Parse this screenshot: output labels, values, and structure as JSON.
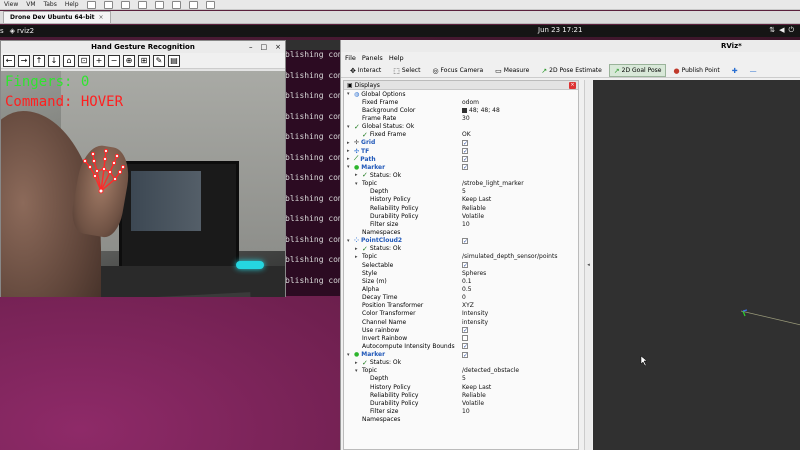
{
  "vm": {
    "menu": [
      "View",
      "VM",
      "Tabs",
      "Help"
    ],
    "tab_label": "Drone Dev Ubuntu 64-bit",
    "tab_close": "×"
  },
  "gnome": {
    "activities": "s",
    "app": "rviz2",
    "clock": "Jun 23  17:21"
  },
  "terminal": {
    "lines": [
      "blishing comma",
      "blishing comma",
      "blishing comma",
      "blishing comma",
      "blishing comma",
      "blishing comma",
      "blishing comma",
      "blishing comma",
      "blishing comma",
      "blishing comma",
      "blishing comma",
      "blishing comma"
    ]
  },
  "hand_window": {
    "title": "Hand Gesture Recognition",
    "minimize": "–",
    "maximize": "□",
    "close": "×",
    "toolbar": [
      "←",
      "→",
      "↑",
      "↓",
      "⌂",
      "⊡",
      "+",
      "−",
      "⊕",
      "⊞",
      "✎",
      "▤"
    ],
    "fingers": "Fingers: 0",
    "command": "Command: HOVER",
    "fingers_color": "#2fe52f",
    "command_color": "#ff2020"
  },
  "rviz": {
    "title": "RViz*",
    "menu": [
      "File",
      "Panels",
      "Help"
    ],
    "tools": [
      {
        "label": "Interact",
        "icon": "✥"
      },
      {
        "label": "Select",
        "icon": "⬚"
      },
      {
        "label": "Focus Camera",
        "icon": "◎"
      },
      {
        "label": "Measure",
        "icon": "▭"
      },
      {
        "label": "2D Pose Estimate",
        "icon": "↗"
      },
      {
        "label": "2D Goal Pose",
        "icon": "↗"
      },
      {
        "label": "Publish Point",
        "icon": "●"
      }
    ],
    "extra_tools": [
      "✚",
      "—"
    ],
    "displays_title": "Displays",
    "displays_close": "×",
    "splitter_arrow": "◂",
    "background_color": "#303030"
  },
  "tree": [
    {
      "indent": 0,
      "arrow": "▾",
      "icon": "globe",
      "label": "Global Options",
      "value": ""
    },
    {
      "indent": 1,
      "label": "Fixed Frame",
      "value": "odom"
    },
    {
      "indent": 1,
      "label": "Background Color",
      "value": "48; 48; 48",
      "swatch": true
    },
    {
      "indent": 1,
      "label": "Frame Rate",
      "value": "30"
    },
    {
      "indent": 0,
      "arrow": "▾",
      "check": true,
      "label": "Global Status: Ok",
      "value": ""
    },
    {
      "indent": 1,
      "check": true,
      "label": "Fixed Frame",
      "value": "OK"
    },
    {
      "indent": 0,
      "arrow": "▸",
      "icon": "grid",
      "label": "Grid",
      "value": "",
      "blue": true,
      "cbx": "✓"
    },
    {
      "indent": 0,
      "arrow": "▸",
      "icon": "tf",
      "label": "TF",
      "value": "",
      "blue": true,
      "cbx": "✓"
    },
    {
      "indent": 0,
      "arrow": "▸",
      "icon": "path",
      "label": "Path",
      "value": "",
      "blue": true,
      "cbx": "✓"
    },
    {
      "indent": 0,
      "arrow": "▾",
      "icon": "marker",
      "label": "Marker",
      "value": "",
      "blue": true,
      "cbx": "✓"
    },
    {
      "indent": 1,
      "arrow": "▸",
      "check": true,
      "label": "Status: Ok",
      "value": ""
    },
    {
      "indent": 1,
      "arrow": "▾",
      "label": "Topic",
      "value": "/strobe_light_marker"
    },
    {
      "indent": 2,
      "label": "Depth",
      "value": "5"
    },
    {
      "indent": 2,
      "label": "History Policy",
      "value": "Keep Last"
    },
    {
      "indent": 2,
      "label": "Reliability Policy",
      "value": "Reliable"
    },
    {
      "indent": 2,
      "label": "Durability Policy",
      "value": "Volatile"
    },
    {
      "indent": 2,
      "label": "Filter size",
      "value": "10"
    },
    {
      "indent": 1,
      "label": "Namespaces",
      "value": ""
    },
    {
      "indent": 0,
      "arrow": "▾",
      "icon": "pc",
      "label": "PointCloud2",
      "value": "",
      "blue": true,
      "cbx": "✓"
    },
    {
      "indent": 1,
      "arrow": "▸",
      "check": true,
      "label": "Status: Ok",
      "value": ""
    },
    {
      "indent": 1,
      "arrow": "▸",
      "label": "Topic",
      "value": "/simulated_depth_sensor/points"
    },
    {
      "indent": 1,
      "label": "Selectable",
      "value": "",
      "cbx": "✓"
    },
    {
      "indent": 1,
      "label": "Style",
      "value": "Spheres"
    },
    {
      "indent": 1,
      "label": "Size (m)",
      "value": "0.1"
    },
    {
      "indent": 1,
      "label": "Alpha",
      "value": "0.5"
    },
    {
      "indent": 1,
      "label": "Decay Time",
      "value": "0"
    },
    {
      "indent": 1,
      "label": "Position Transformer",
      "value": "XYZ"
    },
    {
      "indent": 1,
      "label": "Color Transformer",
      "value": "Intensity"
    },
    {
      "indent": 1,
      "label": "Channel Name",
      "value": "intensity"
    },
    {
      "indent": 1,
      "label": "Use rainbow",
      "value": "",
      "cbx": "✓"
    },
    {
      "indent": 1,
      "label": "Invert Rainbow",
      "value": "",
      "cbx": ""
    },
    {
      "indent": 1,
      "label": "Autocompute Intensity Bounds",
      "value": "",
      "cbx": "✓"
    },
    {
      "indent": 0,
      "arrow": "▾",
      "icon": "marker",
      "label": "Marker",
      "value": "",
      "blue": true,
      "cbx": "✓"
    },
    {
      "indent": 1,
      "arrow": "▸",
      "check": true,
      "label": "Status: Ok",
      "value": ""
    },
    {
      "indent": 1,
      "arrow": "▾",
      "label": "Topic",
      "value": "/detected_obstacle"
    },
    {
      "indent": 2,
      "label": "Depth",
      "value": "5"
    },
    {
      "indent": 2,
      "label": "History Policy",
      "value": "Keep Last"
    },
    {
      "indent": 2,
      "label": "Reliability Policy",
      "value": "Reliable"
    },
    {
      "indent": 2,
      "label": "Durability Policy",
      "value": "Volatile"
    },
    {
      "indent": 2,
      "label": "Filter size",
      "value": "10"
    },
    {
      "indent": 1,
      "label": "Namespaces",
      "value": ""
    }
  ]
}
